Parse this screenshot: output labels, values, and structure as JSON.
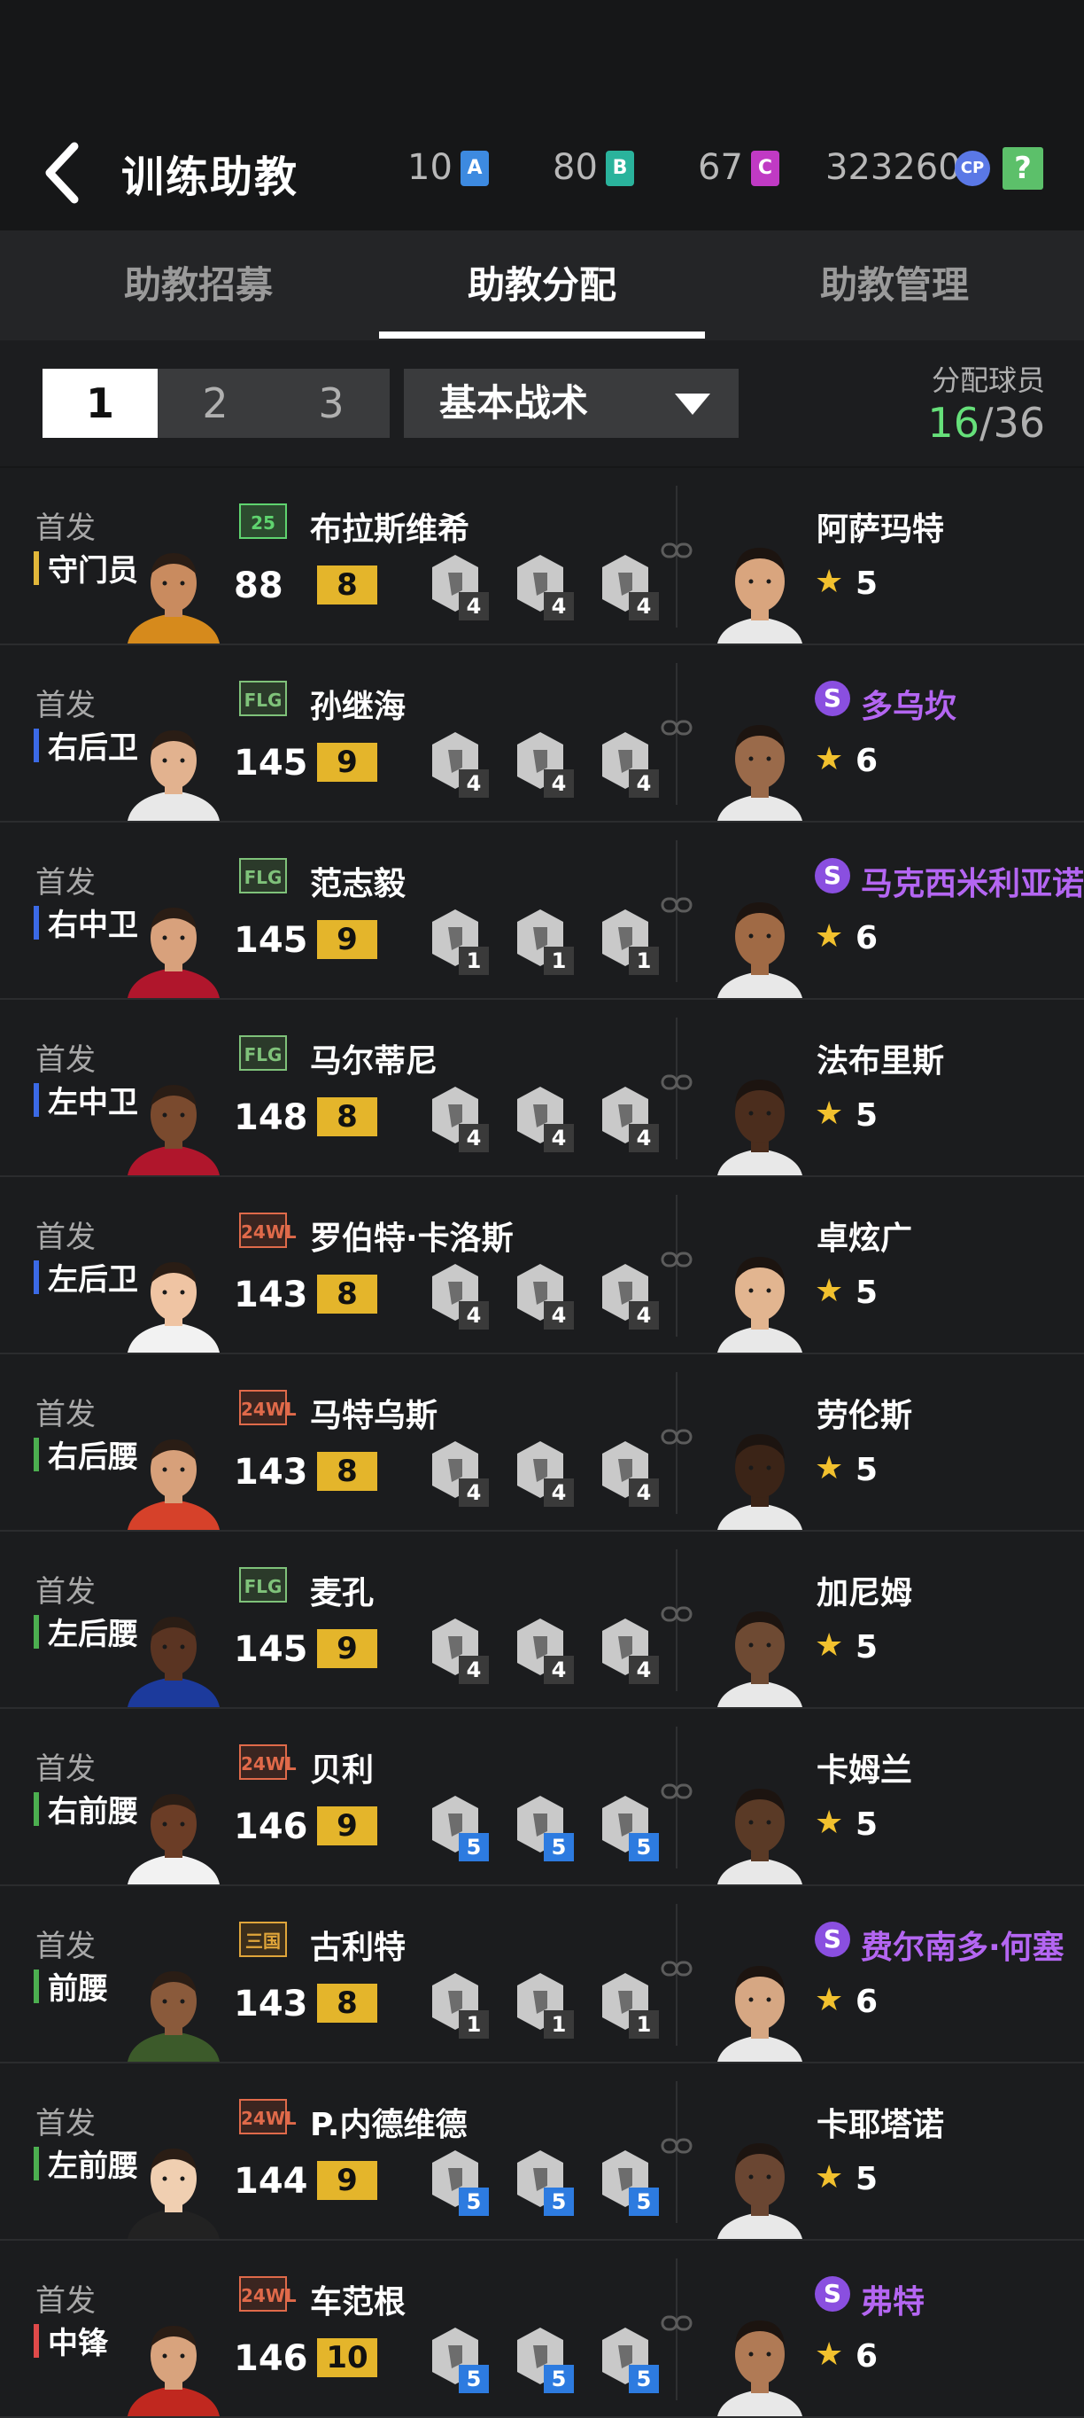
{
  "header": {
    "title": "训练助教",
    "currencies": [
      {
        "value": "10",
        "letter": "A",
        "color": "#3d8ae0"
      },
      {
        "value": "80",
        "letter": "B",
        "color": "#2ab39c"
      },
      {
        "value": "67",
        "letter": "C",
        "color": "#c03ac4"
      },
      {
        "value": "323260",
        "letter": "CP",
        "color": "#5a78e6"
      }
    ],
    "help": "?"
  },
  "tabs": [
    "助教招募",
    "助教分配",
    "助教管理"
  ],
  "active_tab": "助教分配",
  "segments": [
    "1",
    "2",
    "3"
  ],
  "selected_segment": "1",
  "dropdown": {
    "selected": "基本战术"
  },
  "allocation": {
    "label": "分配球员",
    "current": "16",
    "total": "/36"
  },
  "rows": [
    {
      "start": "首发",
      "pos": "守门员",
      "pos_color": "#e2b73a",
      "badge": "25",
      "badge_color": "#5fd46f",
      "badge_bg": "#2c4b2f",
      "player": "布拉斯维希",
      "ovr": "88",
      "lvl": "8",
      "skills": [
        "4",
        "4",
        "4"
      ],
      "skill_color": "#3a3a3a",
      "coach": "阿萨玛特",
      "special": false,
      "stars": "5"
    },
    {
      "start": "首发",
      "pos": "右后卫",
      "pos_color": "#3b6ae6",
      "badge": "FLG",
      "badge_color": "#7fc27a",
      "badge_bg": "#2b3a2a",
      "player": "孙继海",
      "ovr": "145",
      "lvl": "9",
      "skills": [
        "4",
        "4",
        "4"
      ],
      "skill_color": "#3a3a3a",
      "coach": "多乌坎",
      "special": true,
      "stars": "6"
    },
    {
      "start": "首发",
      "pos": "右中卫",
      "pos_color": "#3b6ae6",
      "badge": "FLG",
      "badge_color": "#7fc27a",
      "badge_bg": "#2b3a2a",
      "player": "范志毅",
      "ovr": "145",
      "lvl": "9",
      "skills": [
        "1",
        "1",
        "1"
      ],
      "skill_color": "#3a3a3a",
      "coach": "马克西米利亚诺",
      "special": true,
      "stars": "6"
    },
    {
      "start": "首发",
      "pos": "左中卫",
      "pos_color": "#3b6ae6",
      "badge": "FLG",
      "badge_color": "#7fc27a",
      "badge_bg": "#2b3a2a",
      "player": "马尔蒂尼",
      "ovr": "148",
      "lvl": "8",
      "skills": [
        "4",
        "4",
        "4"
      ],
      "skill_color": "#3a3a3a",
      "coach": "法布里斯",
      "special": false,
      "stars": "5"
    },
    {
      "start": "首发",
      "pos": "左后卫",
      "pos_color": "#3b6ae6",
      "badge": "24WL",
      "badge_color": "#e06a4a",
      "badge_bg": "#3b2520",
      "player": "罗伯特·卡洛斯",
      "ovr": "143",
      "lvl": "8",
      "skills": [
        "4",
        "4",
        "4"
      ],
      "skill_color": "#3a3a3a",
      "coach": "卓炫广",
      "special": false,
      "stars": "5"
    },
    {
      "start": "首发",
      "pos": "右后腰",
      "pos_color": "#4caf50",
      "badge": "24WL",
      "badge_color": "#e06a4a",
      "badge_bg": "#3b2520",
      "player": "马特乌斯",
      "ovr": "143",
      "lvl": "8",
      "skills": [
        "4",
        "4",
        "4"
      ],
      "skill_color": "#3a3a3a",
      "coach": "劳伦斯",
      "special": false,
      "stars": "5"
    },
    {
      "start": "首发",
      "pos": "左后腰",
      "pos_color": "#4caf50",
      "badge": "FLG",
      "badge_color": "#7fc27a",
      "badge_bg": "#2b3a2a",
      "player": "麦孔",
      "ovr": "145",
      "lvl": "9",
      "skills": [
        "4",
        "4",
        "4"
      ],
      "skill_color": "#3a3a3a",
      "coach": "加尼姆",
      "special": false,
      "stars": "5"
    },
    {
      "start": "首发",
      "pos": "右前腰",
      "pos_color": "#4caf50",
      "badge": "24WL",
      "badge_color": "#e06a4a",
      "badge_bg": "#3b2520",
      "player": "贝利",
      "ovr": "146",
      "lvl": "9",
      "skills": [
        "5",
        "5",
        "5"
      ],
      "skill_color": "#2d7be0",
      "coach": "卡姆兰",
      "special": false,
      "stars": "5"
    },
    {
      "start": "首发",
      "pos": "前腰",
      "pos_color": "#4caf50",
      "badge": "三国",
      "badge_color": "#e0a53a",
      "badge_bg": "#3b2e1c",
      "player": "古利特",
      "ovr": "143",
      "lvl": "8",
      "skills": [
        "1",
        "1",
        "1"
      ],
      "skill_color": "#3a3a3a",
      "coach": "费尔南多·何塞",
      "special": true,
      "stars": "6"
    },
    {
      "start": "首发",
      "pos": "左前腰",
      "pos_color": "#4caf50",
      "badge": "24WL",
      "badge_color": "#e06a4a",
      "badge_bg": "#3b2520",
      "player": "P.内德维德",
      "ovr": "144",
      "lvl": "9",
      "skills": [
        "5",
        "5",
        "5"
      ],
      "skill_color": "#2d7be0",
      "coach": "卡耶塔诺",
      "special": false,
      "stars": "5"
    },
    {
      "start": "首发",
      "pos": "中锋",
      "pos_color": "#e04a4a",
      "badge": "24WL",
      "badge_color": "#e06a4a",
      "badge_bg": "#3b2520",
      "player": "车范根",
      "ovr": "146",
      "lvl": "10",
      "skills": [
        "5",
        "5",
        "5"
      ],
      "skill_color": "#2d7be0",
      "coach": "弗特",
      "special": true,
      "stars": "6"
    }
  ]
}
